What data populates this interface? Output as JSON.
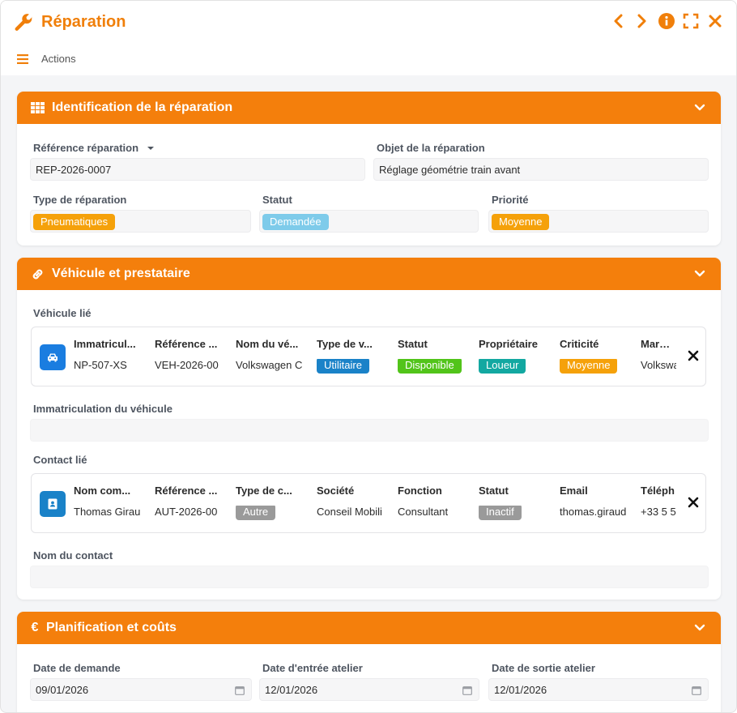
{
  "window": {
    "title": "Réparation"
  },
  "toolbar": {
    "actions_label": "Actions"
  },
  "colors": {
    "accent": "#f07f0a",
    "panel_header": "#f47f0c"
  },
  "sections": {
    "identification": {
      "title": "Identification de la réparation",
      "reference_label": "Référence réparation",
      "reference_value": "REP-2026-0007",
      "object_label": "Objet de la réparation",
      "object_value": "Réglage géométrie train avant",
      "type_label": "Type de réparation",
      "type_value": {
        "text": "Pneumatiques",
        "color": "#f5a10a"
      },
      "status_label": "Statut",
      "status_value": {
        "text": "Demandée",
        "color": "#7ecbea"
      },
      "priority_label": "Priorité",
      "priority_value": {
        "text": "Moyenne",
        "color": "#f5a10a"
      }
    },
    "vehicle": {
      "title": "Véhicule et prestataire",
      "linked_vehicle_label": "Véhicule lié",
      "vehicle_card": {
        "icon": "car-icon",
        "icon_color": "#1a7de0",
        "columns": [
          {
            "header": "Immatricul...",
            "value": "NP-507-XS"
          },
          {
            "header": "Référence ...",
            "value": "VEH-2026-00"
          },
          {
            "header": "Nom du vé...",
            "value": "Volkswagen C"
          },
          {
            "header": "Type de v...",
            "value": "Utilitaire",
            "pill_color": "#1a82c8"
          },
          {
            "header": "Statut",
            "value": "Disponible",
            "pill_color": "#52c41a"
          },
          {
            "header": "Propriétaire",
            "value": "Loueur",
            "pill_color": "#13a8a1"
          },
          {
            "header": "Criticité",
            "value": "Moyenne",
            "pill_color": "#f5a10a"
          },
          {
            "header": "Marque",
            "value": "Volkswa"
          }
        ]
      },
      "vehicle_plate_label": "Immatriculation du véhicule",
      "vehicle_plate_value": "",
      "linked_contact_label": "Contact lié",
      "contact_card": {
        "icon": "contact-card-icon",
        "icon_color": "#1a82c8",
        "columns": [
          {
            "header": "Nom com...",
            "value": "Thomas Girau"
          },
          {
            "header": "Référence ...",
            "value": "AUT-2026-00"
          },
          {
            "header": "Type de c...",
            "value": "Autre",
            "pill_color": "#9a9a9a"
          },
          {
            "header": "Société",
            "value": "Conseil Mobili"
          },
          {
            "header": "Fonction",
            "value": "Consultant"
          },
          {
            "header": "Statut",
            "value": "Inactif",
            "pill_color": "#9a9a9a"
          },
          {
            "header": "Email",
            "value": "thomas.giraud"
          },
          {
            "header": "Téléph",
            "value": "+33 5 5"
          }
        ]
      },
      "contact_name_label": "Nom du contact",
      "contact_name_value": ""
    },
    "planning": {
      "title": "Planification et coûts",
      "request_date_label": "Date de demande",
      "request_date_value": "09/01/2026",
      "entry_date_label": "Date d'entrée atelier",
      "entry_date_value": "12/01/2026",
      "exit_date_label": "Date de sortie atelier",
      "exit_date_value": "12/01/2026"
    }
  }
}
